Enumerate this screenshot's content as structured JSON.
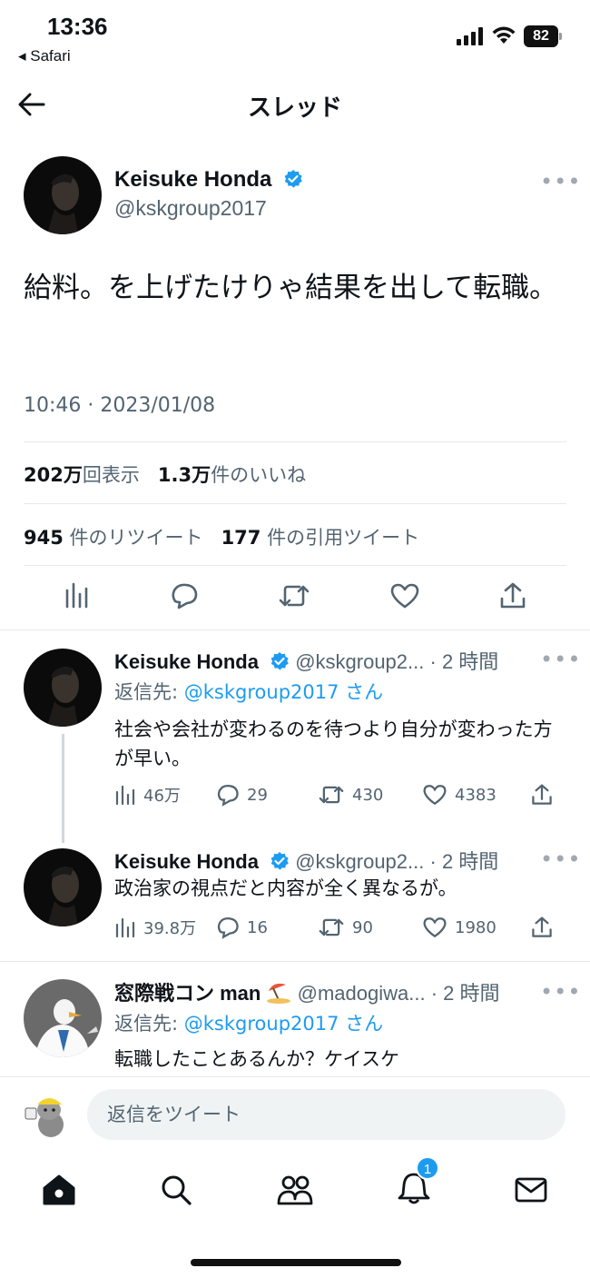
{
  "status": {
    "time": "13:36",
    "back_app": "◂ Safari",
    "battery": "82"
  },
  "nav": {
    "title": "スレッド"
  },
  "main_tweet": {
    "name": "Keisuke Honda",
    "handle": "@kskgroup2017",
    "text": "給料。を上げたけりゃ結果を出して転職。",
    "timestamp": "10:46 · 2023/01/08",
    "views_num": "202万",
    "views_label": "回表示",
    "likes_num": "1.3万",
    "likes_label": "件のいいね",
    "retweets_num": "945",
    "retweets_label": "件のリツイート",
    "quotes_num": "177",
    "quotes_label": "件の引用ツイート"
  },
  "replies": [
    {
      "name": "Keisuke Honda",
      "handle": "@kskgroup2...",
      "time": "· 2 時間",
      "reply_prefix": "返信先: ",
      "reply_to": "@kskgroup2017 さん",
      "text": "社会や会社が変わるのを待つより自分が変わった方が早い。",
      "views": "46万",
      "replies": "29",
      "retweets": "430",
      "likes": "4383"
    },
    {
      "name": "Keisuke Honda",
      "handle": "@kskgroup2...",
      "time": "· 2 時間",
      "text": "政治家の視点だと内容が全く異なるが。",
      "views": "39.8万",
      "replies": "16",
      "retweets": "90",
      "likes": "1980"
    },
    {
      "name": "窓際戦コン man",
      "handle": "@madogiwa...",
      "time": "· 2 時間",
      "reply_prefix": "返信先: ",
      "reply_to": "@kskgroup2017 さん",
      "text": "転職したことあるんか？ケイスケ"
    }
  ],
  "compose": {
    "placeholder": "返信をツイート"
  },
  "tabbar": {
    "notification_count": "1"
  },
  "colors": {
    "accent": "#1d9bf0",
    "text": "#0f1419",
    "secondary": "#536471"
  }
}
